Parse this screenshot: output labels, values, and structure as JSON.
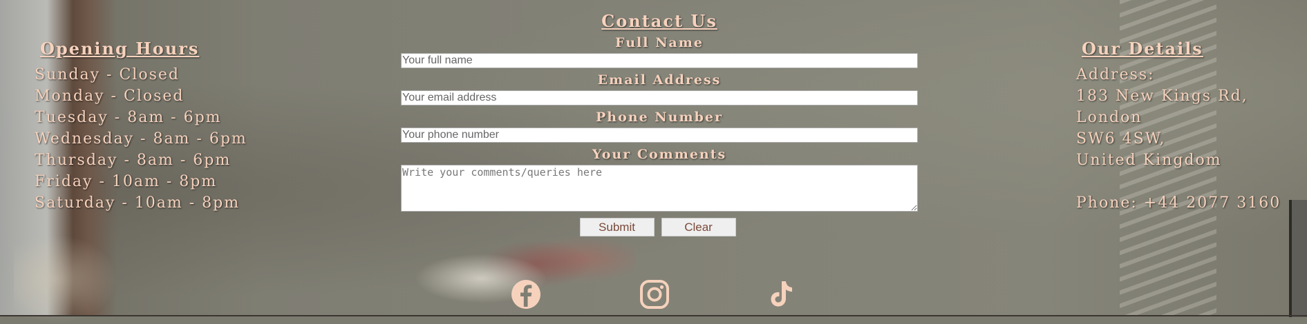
{
  "opening_hours": {
    "title": "Opening Hours",
    "days": [
      "Sunday - Closed",
      "Monday - Closed",
      "Tuesday - 8am - 6pm",
      "Wednesday - 8am - 6pm",
      "Thursday - 8am - 6pm",
      "Friday - 10am - 8pm",
      "Saturday - 10am - 8pm"
    ]
  },
  "contact": {
    "title": "Contact Us",
    "full_name_label": "Full Name",
    "full_name_placeholder": "Your full name",
    "email_label": "Email Address",
    "email_placeholder": "Your email address",
    "phone_label": "Phone Number",
    "phone_placeholder": "Your phone number",
    "comments_label": "Your Comments",
    "comments_placeholder": "Write your comments/queries here",
    "submit_label": "Submit",
    "clear_label": "Clear"
  },
  "details": {
    "title": "Our Details",
    "address_label": "Address:",
    "address_lines": [
      "183 New Kings Rd,",
      "London",
      "SW6 4SW,",
      "United Kingdom"
    ],
    "phone": "Phone: +44 2077 3160"
  },
  "social": {
    "icons": [
      "facebook-icon",
      "instagram-icon",
      "tiktok-icon"
    ]
  },
  "colors": {
    "heading_text": "#f6d2bd",
    "button_text": "#7a4a3a",
    "button_bg": "#efefef"
  }
}
